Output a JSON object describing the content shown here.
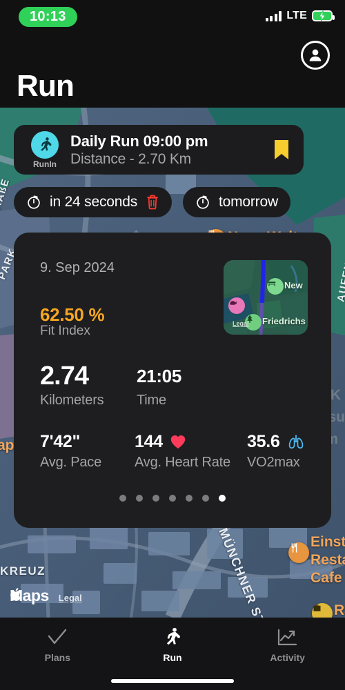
{
  "status_bar": {
    "time": "10:13",
    "network": "LTE",
    "signal_icon": "signal-bars-icon",
    "battery_icon": "battery-charging-icon",
    "time_pill_color": "#30D158"
  },
  "header": {
    "title": "Run",
    "avatar_icon": "account-circle-icon"
  },
  "run_card": {
    "app_icon": "running-person-icon",
    "app_name": "RunIn",
    "title": "Daily Run 09:00 pm",
    "subtitle": "Distance  -  2.70 Km",
    "bookmark_icon": "bookmark-icon",
    "bookmark_color": "#F7CE2E",
    "icon_bg_color": "#4FD8E8"
  },
  "timer_chips": [
    {
      "icon": "timer-icon",
      "label": "in 24 seconds",
      "delete_icon": "trash-icon",
      "delete_color": "#FF3B30",
      "has_delete": true
    },
    {
      "icon": "timer-icon",
      "label": "tomorrow",
      "has_delete": false
    }
  ],
  "stats_panel": {
    "date": "9. Sep 2024",
    "fit_index": {
      "value": "62.50 %",
      "label": "Fit Index",
      "color": "#F5A623"
    },
    "thumbnail": {
      "legal_label": "Legal",
      "pins": [
        {
          "icon": "bench-icon",
          "label": "New",
          "color": "#7FD88F"
        },
        {
          "icon": "animal-icon",
          "label": "",
          "color": "#E878B8"
        },
        {
          "icon": "tree-icon",
          "label": "Friedrichs",
          "color": "#6FCF7F"
        }
      ]
    },
    "primary_stats": [
      {
        "value": "2.74",
        "label": "Kilometers",
        "size": "large"
      },
      {
        "value": "21:05",
        "label": "Time",
        "size": "medium"
      }
    ],
    "secondary_stats": [
      {
        "value": "7'42\"",
        "label": "Avg. Pace",
        "icon": ""
      },
      {
        "value": "144",
        "label": "Avg. Heart Rate",
        "icon": "heart-icon"
      },
      {
        "value": "35.6",
        "label": "VO2max",
        "icon": "lungs-icon"
      }
    ],
    "page_dots": {
      "total": 7,
      "active_index": 6
    }
  },
  "map": {
    "attribution": "Maps",
    "apple_logo_icon": "apple-logo-icon",
    "legal_link": "Legal",
    "poi_labels": [
      {
        "text": "Neue Welt",
        "icon": "restaurant-icon"
      },
      {
        "text": "Einstein",
        "icon": "restaurant-icon"
      },
      {
        "text": "Restaur",
        "icon": ""
      },
      {
        "text": "Cafe Ba",
        "icon": ""
      },
      {
        "text": "Ra",
        "icon": "briefcase-icon"
      },
      {
        "text": "apoli",
        "icon": ""
      }
    ],
    "street_labels": [
      "MÜNCHNER STRAßE",
      "KREUZ",
      "PARK",
      "STRAßE",
      "AUFEN"
    ],
    "ghost_labels": [
      "AOK",
      "Gesu",
      "Um",
      "esu"
    ]
  },
  "tab_bar": {
    "tabs": [
      {
        "label": "Plans",
        "icon": "check-icon",
        "active": false
      },
      {
        "label": "Run",
        "icon": "running-person-icon",
        "active": true
      },
      {
        "label": "Activity",
        "icon": "chart-trend-icon",
        "active": false
      }
    ]
  }
}
